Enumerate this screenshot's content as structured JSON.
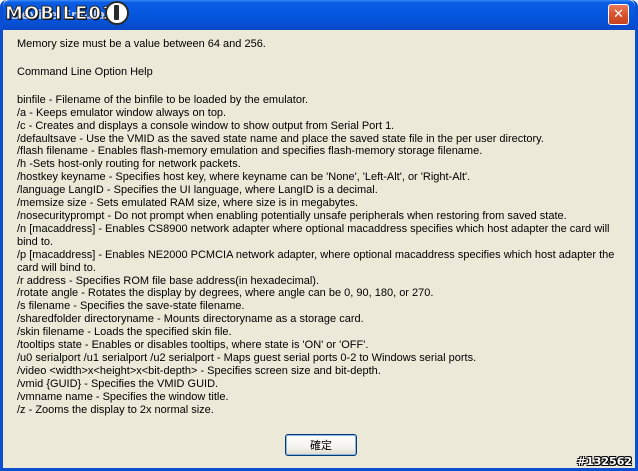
{
  "window": {
    "title": "Device Emulator",
    "logo_text": "MOBILE01",
    "close_glyph": "✕",
    "titlebar_color": "#0558df"
  },
  "dialog": {
    "message": "Memory size must be a value between 64 and 256.",
    "section_title": "Command Line Option Help",
    "options": [
      "binfile - Filename of the binfile to be loaded by the emulator.",
      "/a - Keeps emulator window always on top.",
      "/c - Creates and displays a console window to show output from Serial Port 1.",
      "/defaultsave - Use the VMID as the saved state name and place the saved state file in the per user directory.",
      "/flash filename - Enables flash-memory emulation and specifies flash-memory storage filename.",
      "/h -Sets host-only routing for network packets.",
      "/hostkey keyname - Specifies host key, where keyname can be 'None', 'Left-Alt', or 'Right-Alt'.",
      "/language LangID - Specifies the UI language, where LangID is a decimal.",
      "/memsize size - Sets emulated RAM size, where size is in megabytes.",
      "/nosecurityprompt - Do not prompt when enabling potentially unsafe peripherals when restoring from saved state.",
      "/n [macaddress] - Enables CS8900 network adapter where optional macaddress specifies which host adapter the card will bind to.",
      "/p [macaddress] - Enables NE2000 PCMCIA network adapter, where optional macaddress specifies which host adapter the card will bind to.",
      "/r address - Specifies ROM file base address(in hexadecimal).",
      "/rotate angle - Rotates the display by degrees, where angle can be 0, 90, 180, or 270.",
      "/s filename - Specifies the save-state filename.",
      "/sharedfolder directoryname - Mounts directoryname as a storage card.",
      "/skin filename - Loads the specified skin file.",
      "/tooltips state - Enables or disables tooltips, where state is 'ON' or 'OFF'.",
      "/u0 serialport /u1 serialport /u2 serialport - Maps guest serial ports 0-2 to Windows serial ports.",
      "/video <width>x<height>x<bit-depth> - Specifies screen size and bit-depth.",
      "/vmid {GUID} - Specifies the VMID GUID.",
      "/vmname name - Specifies the window title.",
      "/z - Zooms the display to 2x normal size."
    ],
    "ok_label": "確定"
  },
  "watermark": "#132562"
}
